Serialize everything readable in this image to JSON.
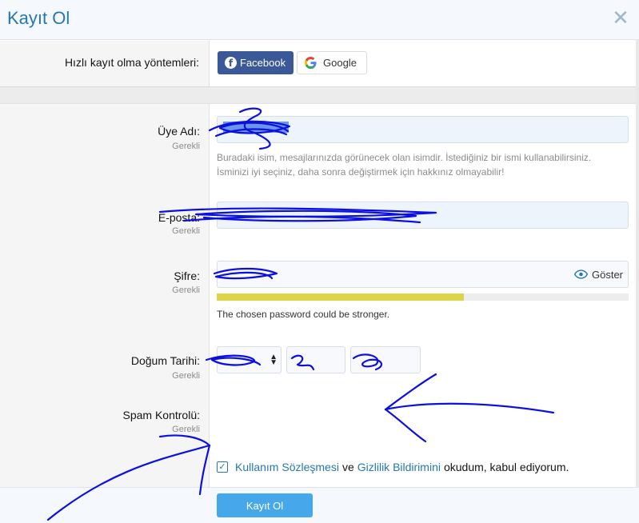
{
  "dialog": {
    "title": "Kayıt Ol"
  },
  "quick_register": {
    "label": "Hızlı kayıt olma yöntemleri:",
    "facebook_label": "Facebook",
    "google_label": "Google"
  },
  "fields": {
    "username": {
      "label": "Üye Adı:",
      "required": "Gerekli",
      "hint_line1": "Buradaki isim, mesajlarınızda görünecek olan isimdir. İstediğiniz bir ismi kullanabilirsiniz.",
      "hint_line2": "İsminizi iyi seçiniz, daha sonra değiştirmek için hakkınız olmayabilir!"
    },
    "email": {
      "label": "E-posta:",
      "required": "Gerekli"
    },
    "password": {
      "label": "Şifre:",
      "required": "Gerekli",
      "show_label": "Göster",
      "strength": 0.6,
      "strength_text": "The chosen password could be stronger."
    },
    "birthdate": {
      "label": "Doğum Tarihi:",
      "required": "Gerekli"
    },
    "spam": {
      "label": "Spam Kontrolü:",
      "required": "Gerekli"
    }
  },
  "terms": {
    "link1": "Kullanım Sözleşmesi",
    "and": "ve",
    "link2": "Gizlilik Bildirimini",
    "suffix": "okudum, kabul ediyorum."
  },
  "submit_label": "Kayıt Ol",
  "colors": {
    "accent": "#2577b1",
    "facebook": "#3b5998",
    "submit": "#47a7eb",
    "meter": "#dcd54a",
    "ink": "#0b10e0"
  },
  "icons": {
    "close": "close-icon",
    "facebook": "facebook-icon",
    "google": "google-icon",
    "eye": "eye-icon",
    "check": "checkbox-check-icon"
  }
}
